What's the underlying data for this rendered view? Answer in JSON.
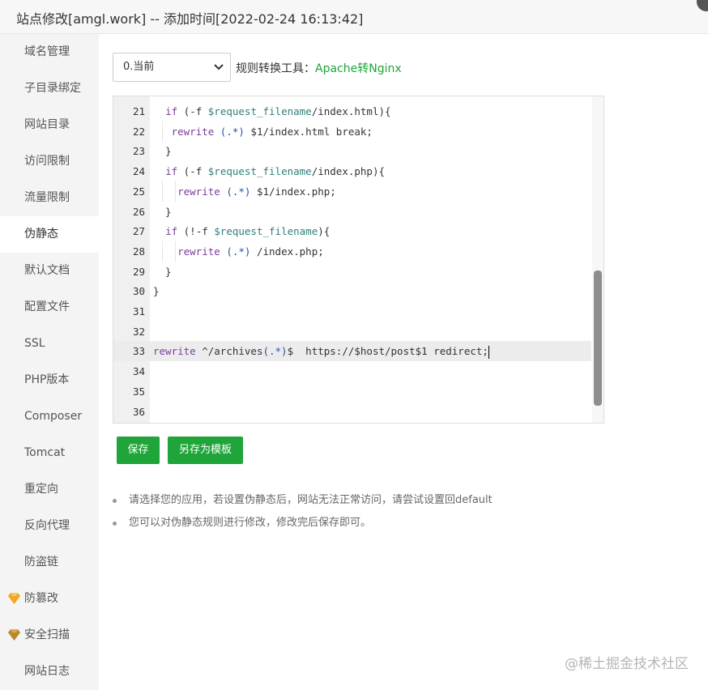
{
  "window": {
    "title": "站点修改[amgl.work] -- 添加时间[2022-02-24 16:13:42]"
  },
  "sidebar": {
    "items": [
      {
        "label": "域名管理"
      },
      {
        "label": "子目录绑定"
      },
      {
        "label": "网站目录"
      },
      {
        "label": "访问限制"
      },
      {
        "label": "流量限制"
      },
      {
        "label": "伪静态"
      },
      {
        "label": "默认文档"
      },
      {
        "label": "配置文件"
      },
      {
        "label": "SSL"
      },
      {
        "label": "PHP版本"
      },
      {
        "label": "Composer"
      },
      {
        "label": "Tomcat"
      },
      {
        "label": "重定向"
      },
      {
        "label": "反向代理"
      },
      {
        "label": "防盗链"
      },
      {
        "label": "防篡改",
        "icon": "gem-icon"
      },
      {
        "label": "安全扫描",
        "icon": "gem-icon"
      },
      {
        "label": "网站日志"
      }
    ],
    "active": "伪静态"
  },
  "toolbar": {
    "select_value": "0.当前",
    "tool_label": "规则转换工具：",
    "tool_link": "Apache转Nginx"
  },
  "editor": {
    "lines": [
      {
        "n": "21",
        "code": "  if (-f $request_filename/index.html){"
      },
      {
        "n": "22",
        "code": "   rewrite (.*) $1/index.html break;"
      },
      {
        "n": "23",
        "code": "  }"
      },
      {
        "n": "24",
        "code": "  if (-f $request_filename/index.php){"
      },
      {
        "n": "25",
        "code": "    rewrite (.*) $1/index.php;"
      },
      {
        "n": "26",
        "code": "  }"
      },
      {
        "n": "27",
        "code": "  if (!-f $request_filename){"
      },
      {
        "n": "28",
        "code": "    rewrite (.*) /index.php;"
      },
      {
        "n": "29",
        "code": "  }"
      },
      {
        "n": "30",
        "code": "}"
      },
      {
        "n": "31",
        "code": ""
      },
      {
        "n": "32",
        "code": ""
      },
      {
        "n": "33",
        "code": "rewrite ^/archives(.*)$  https://$host/post$1 redirect;"
      },
      {
        "n": "34",
        "code": ""
      },
      {
        "n": "35",
        "code": ""
      },
      {
        "n": "36",
        "code": ""
      }
    ],
    "active_line": "33"
  },
  "buttons": {
    "save": "保存",
    "save_template": "另存为模板"
  },
  "tips": [
    "请选择您的应用，若设置伪静态后，网站无法正常访问，请尝试设置回default",
    "您可以对伪静态规则进行修改，修改完后保存即可。"
  ],
  "watermark": "@稀土掘金技术社区",
  "colors": {
    "accent": "#20a53a",
    "keyword": "#7a3e9d",
    "variable": "#2f7f7a",
    "regex": "#2b4fa3",
    "gem": "#f4a524"
  }
}
